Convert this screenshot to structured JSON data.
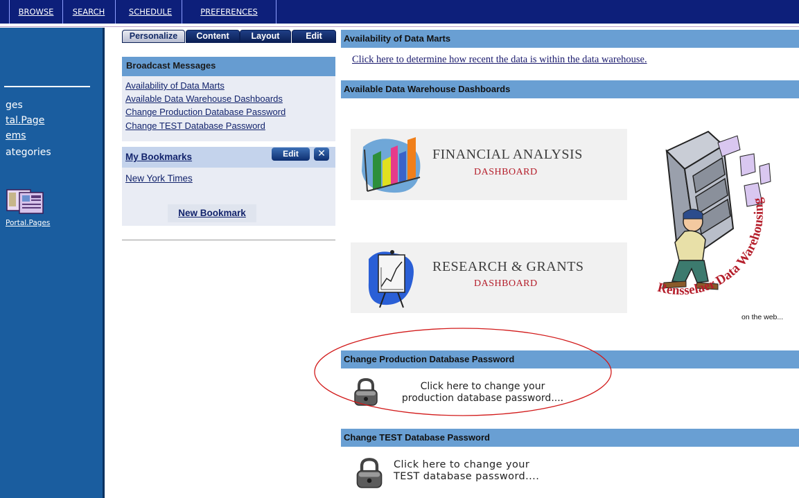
{
  "topnav": {
    "tabs": [
      "BROWSE",
      "SEARCH",
      "SCHEDULE",
      "PREFERENCES"
    ]
  },
  "sidebar": {
    "items": [
      "ges",
      "tal.Page",
      "ems",
      "ategories"
    ],
    "icon_label": "Portal.Pages"
  },
  "tabs": [
    "Personalize",
    "Content",
    "Layout",
    "Edit"
  ],
  "broadcast": {
    "title": "Broadcast Messages",
    "links": [
      "Availability of Data Marts",
      "Available Data Warehouse Dashboards",
      "Change Production Database Password",
      "Change TEST Database Password"
    ]
  },
  "bookmarks": {
    "title": "My Bookmarks",
    "edit_label": "Edit",
    "close_glyph": "✕",
    "items": [
      "New York Times"
    ],
    "new_label": "New Bookmark"
  },
  "main": {
    "datamarts_title": "Availability of Data Marts",
    "datamarts_link": "Click here to determine how recent the data is within the data warehouse.",
    "dashboards_title": "Available Data Warehouse Dashboards",
    "financial": {
      "line1": "FINANCIAL ANALYSIS",
      "line2": "DASHBOARD"
    },
    "research": {
      "line1": "RESEARCH & GRANTS",
      "line2": "DASHBOARD"
    },
    "rensselaer_caption": "on the web...",
    "logo_arc_text": "Rensselaer Data Warehousing",
    "prod_title": "Change Production Database Password",
    "prod_text_1": "Click here to change your",
    "prod_text_2": "production database password....",
    "test_title": "Change TEST Database Password",
    "test_text_1": "Click here to change your",
    "test_text_2": "TEST database password....",
    "colors": {
      "header_blue": "#699fd3",
      "nav": "#0d1f7a",
      "sidebar": "#1a5d9f",
      "accent_red": "#b51e2b"
    }
  }
}
